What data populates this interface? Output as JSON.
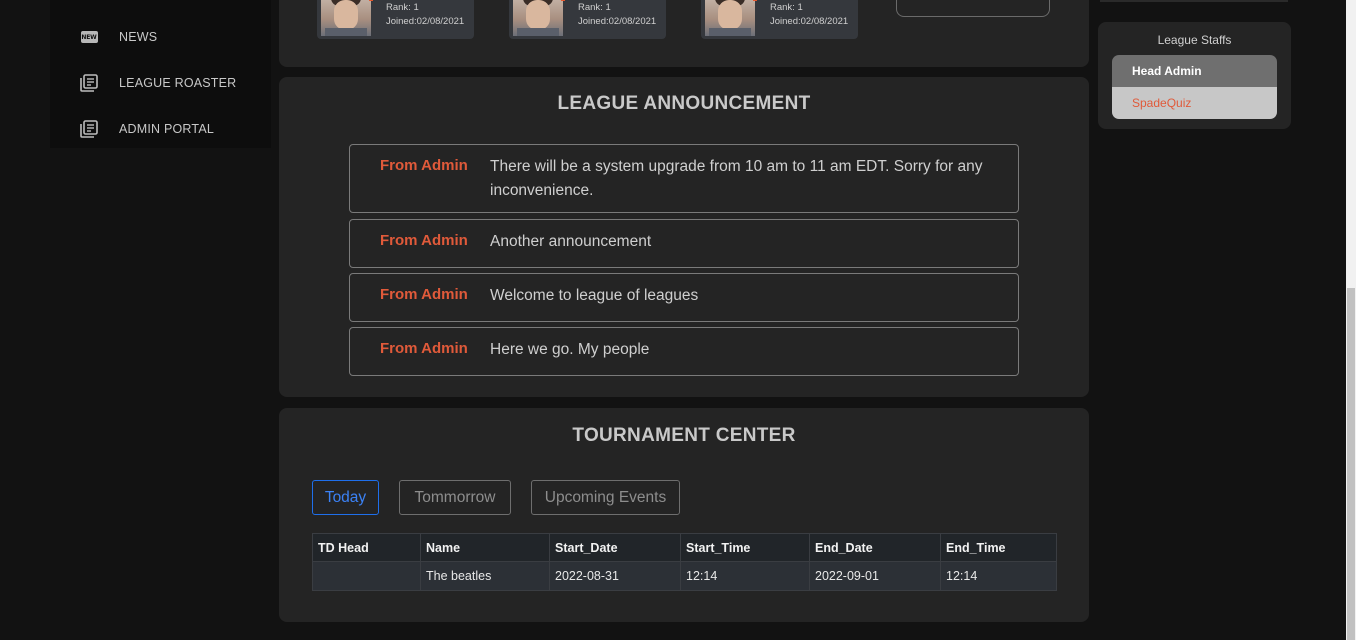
{
  "sidebar": {
    "items": [
      {
        "label": "NEWS",
        "icon": "new-badge-icon",
        "badge": "NEW"
      },
      {
        "label": "LEAGUE ROASTER",
        "icon": "document-stack-icon"
      },
      {
        "label": "ADMIN PORTAL",
        "icon": "document-stack-icon"
      }
    ]
  },
  "players": [
    {
      "rank": "Rank: 1",
      "joined": "Joined:02/08/2021"
    },
    {
      "rank": "Rank: 1",
      "joined": "Joined:02/08/2021"
    },
    {
      "rank": "Rank: 1",
      "joined": "Joined:02/08/2021"
    }
  ],
  "announcements": {
    "title": "LEAGUE ANNOUNCEMENT",
    "items": [
      {
        "from": "From Admin",
        "message": "There will be a system upgrade from 10 am to 11 am EDT. Sorry for any inconvenience."
      },
      {
        "from": "From Admin",
        "message": "Another announcement"
      },
      {
        "from": "From Admin",
        "message": "Welcome to league of leagues"
      },
      {
        "from": "From Admin",
        "message": "Here we go. My people"
      }
    ]
  },
  "tournament": {
    "title": "TOURNAMENT CENTER",
    "tabs": [
      "Today",
      "Tommorrow",
      "Upcoming Events"
    ],
    "columns": [
      "TD Head",
      "Name",
      "Start_Date",
      "Start_Time",
      "End_Date",
      "End_Time"
    ],
    "rows": [
      [
        "",
        "The beatles",
        "2022-08-31",
        "12:14",
        "2022-09-01",
        "12:14"
      ]
    ]
  },
  "staff": {
    "title": "League Staffs",
    "head_label": "Head Admin",
    "members": [
      "SpadeQuiz"
    ]
  },
  "colors": {
    "accent_orange": "#e05a3a",
    "accent_blue": "#3b82f6",
    "panel_bg": "#242424",
    "page_bg": "#121212"
  }
}
